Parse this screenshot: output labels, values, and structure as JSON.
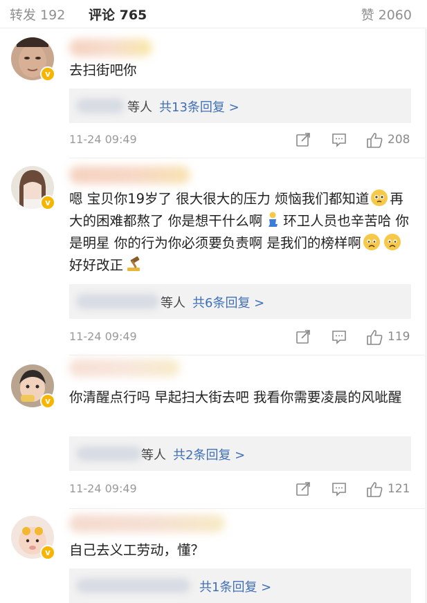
{
  "tabs": {
    "repost": "转发 192",
    "comments": "评论 765",
    "likes": "赞 2060"
  },
  "colors": {
    "accent_link": "#3f6fb5",
    "verified_badge": "#f7b500"
  },
  "comments": [
    {
      "text": "去扫街吧你",
      "reply_tail": "等人",
      "reply_link": "共13条回复 >",
      "time": "11-24 09:49",
      "likes": "208",
      "avatar_icon": "man-portrait"
    },
    {
      "text_parts": [
        "嗯 宝贝你19岁了 很大很大的压力 烦恼我们都知道",
        "再大的困难都熬了 你是想干什么啊",
        "环卫人员也辛苦哈 你是明星 你的行为你必须要负责啊 是我们的榜样啊",
        "好好改正"
      ],
      "reply_tail": "等人",
      "reply_link": "共6条回复 >",
      "time": "11-24 09:49",
      "likes": "119",
      "avatar_icon": "girl-portrait"
    },
    {
      "text": "你清醒点行吗 早起扫大街去吧 我看你需要凌晨的风呲醒",
      "reply_tail": "等人",
      "reply_link": "共2条回复 >",
      "time": "11-24 09:49",
      "likes": "121",
      "avatar_icon": "child-portrait"
    },
    {
      "text": "自己去义工劳动，懂？",
      "reply_tail": "",
      "reply_link": "共1条回复 >",
      "avatar_icon": "cartoon-portrait"
    }
  ]
}
